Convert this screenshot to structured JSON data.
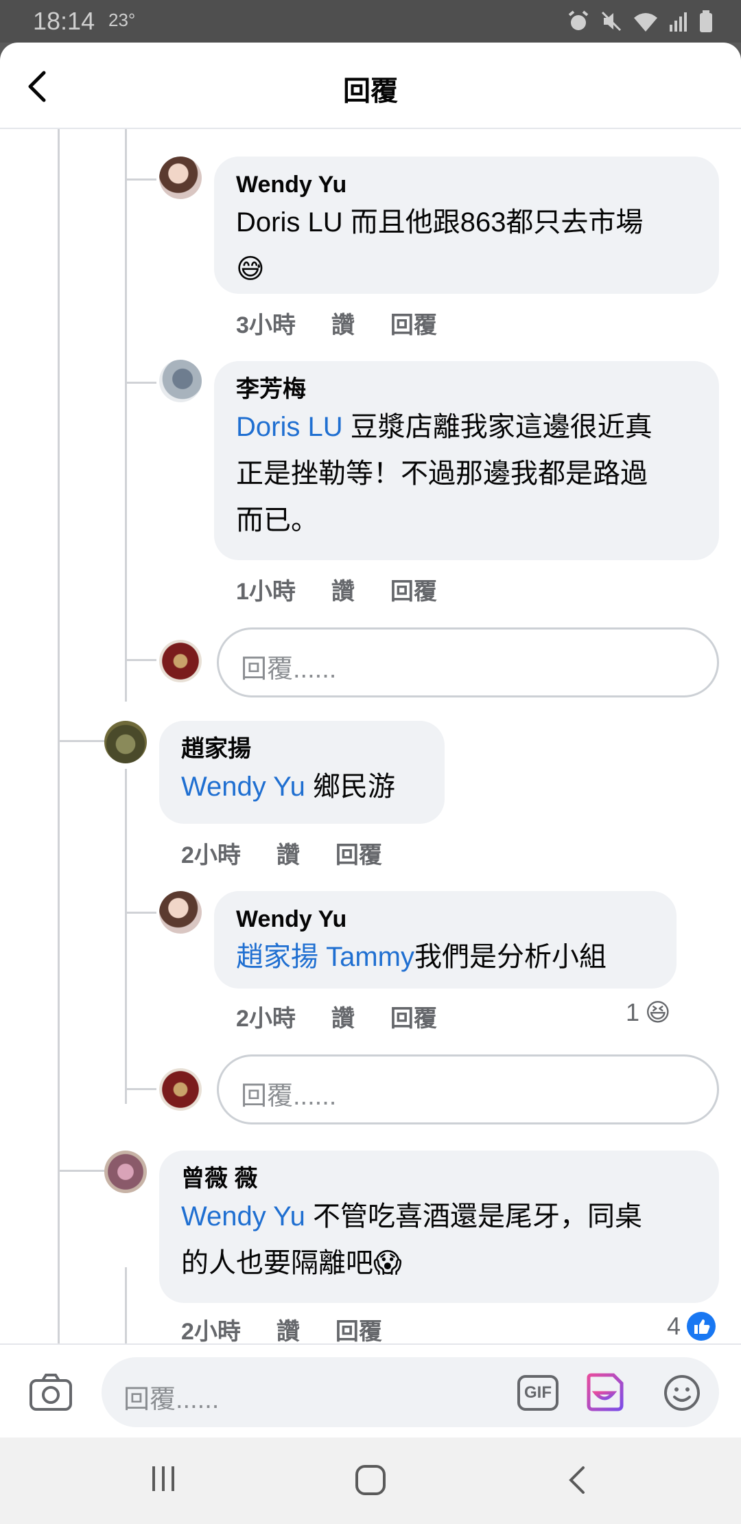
{
  "status": {
    "time": "18:14",
    "temp": "23°"
  },
  "header": {
    "title": "回覆"
  },
  "comments": [
    {
      "name": "Wendy Yu",
      "text_plain": "Doris LU 而且他跟863都只去市場",
      "emoji": "😅",
      "time": "3小時",
      "like": "讚",
      "reply": "回覆"
    },
    {
      "name": "李芳梅",
      "mention": "Doris LU",
      "text_l1": " 豆漿店離我家這邊很近真",
      "text_l2": "正是挫勒等！不過那邊我都是路過",
      "text_l3": "而已。",
      "time": "1小時",
      "like": "讚",
      "reply": "回覆"
    },
    {
      "name": "趙家揚",
      "mention": "Wendy Yu",
      "text": " 鄉民游",
      "time": "2小時",
      "like": "讚",
      "reply": "回覆"
    },
    {
      "name": "Wendy Yu",
      "mention": "趙家揚 Tammy",
      "text": "我們是分析小組",
      "time": "2小時",
      "like": "讚",
      "reply": "回覆",
      "reaction_count": "1",
      "reaction_emoji": "😆"
    },
    {
      "name": "曾薇 薇",
      "mention": "Wendy Yu",
      "text_l1": " 不管吃喜酒還是尾牙，同桌",
      "text_l2": "的人也要隔離吧",
      "emoji": "😱",
      "time": "2小時",
      "like": "讚",
      "reply": "回覆",
      "reaction_count": "4"
    }
  ],
  "reply_placeholder": "回覆......",
  "composer": {
    "placeholder": "回覆......",
    "gif": "GIF"
  }
}
